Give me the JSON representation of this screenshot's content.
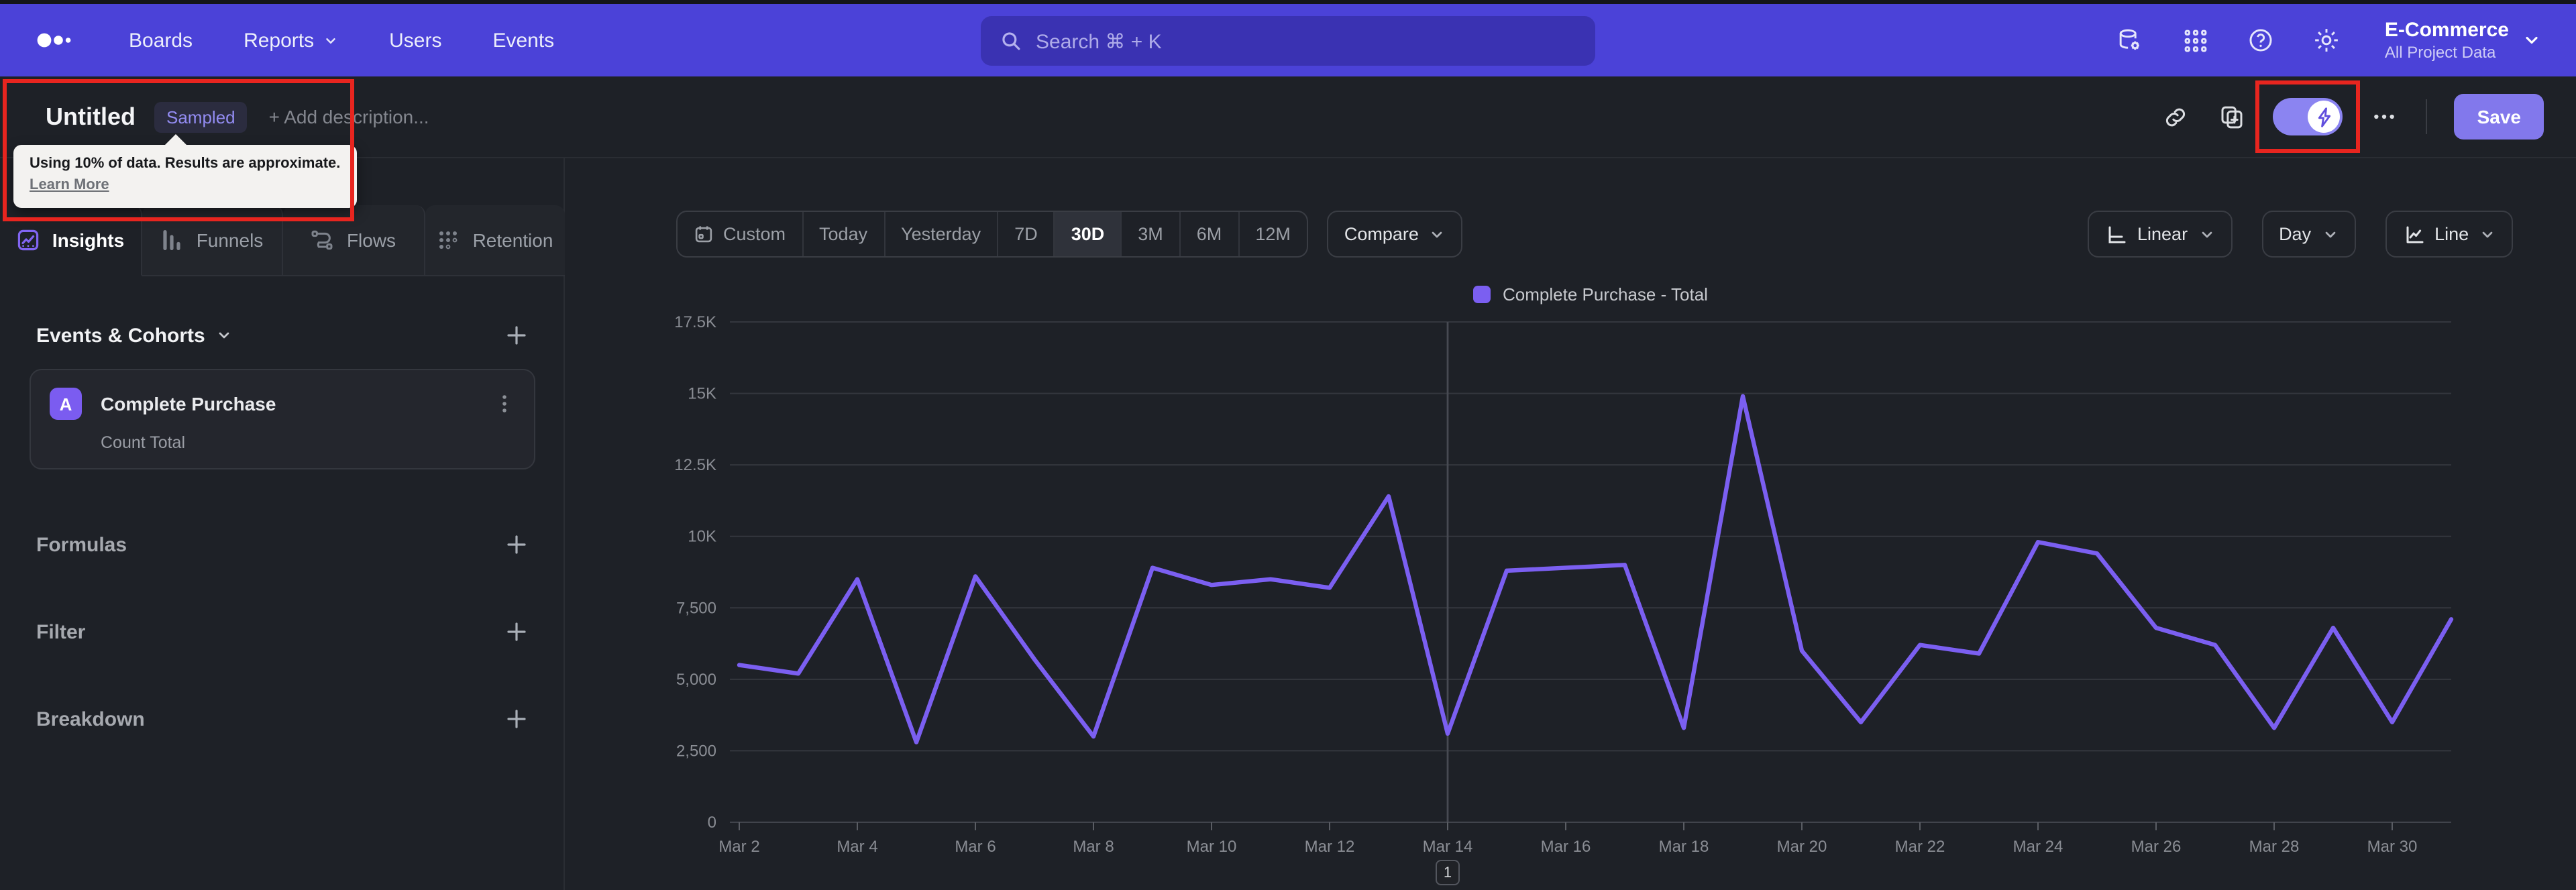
{
  "colors": {
    "nav_background": "#4b42d8",
    "page_background": "#1e2127",
    "accent_purple": "#7b5ff1",
    "save_button": "#8278ec",
    "annotation_red": "#e8251f",
    "tooltip_background": "#f3f2f0"
  },
  "nav": {
    "links": [
      "Boards",
      "Reports",
      "Users",
      "Events"
    ],
    "search_placeholder": "Search  ⌘ + K",
    "project": {
      "name": "E-Commerce",
      "scope": "All Project Data"
    }
  },
  "titlebar": {
    "title": "Untitled",
    "badge": "Sampled",
    "add_description": "+ Add description...",
    "save_label": "Save"
  },
  "tooltip": {
    "line1": "Using 10% of data. Results are approximate.",
    "link": "Learn More"
  },
  "sidebar": {
    "tabs": [
      "Insights",
      "Funnels",
      "Flows",
      "Retention"
    ],
    "active_tab": "Insights",
    "events_header": "Events & Cohorts",
    "event": {
      "letter": "A",
      "name": "Complete Purchase",
      "metric": "Count Total"
    },
    "sections": [
      "Formulas",
      "Filter",
      "Breakdown"
    ]
  },
  "controls": {
    "date_ranges": [
      "Custom",
      "Today",
      "Yesterday",
      "7D",
      "30D",
      "3M",
      "6M",
      "12M"
    ],
    "active_range": "30D",
    "compare": "Compare",
    "scale": "Linear",
    "granularity": "Day",
    "chart_type": "Line"
  },
  "chart_data": {
    "type": "line",
    "title": "",
    "categories": [
      "Mar 2",
      "Mar 3",
      "Mar 4",
      "Mar 5",
      "Mar 6",
      "Mar 7",
      "Mar 8",
      "Mar 9",
      "Mar 10",
      "Mar 11",
      "Mar 12",
      "Mar 13",
      "Mar 14",
      "Mar 15",
      "Mar 16",
      "Mar 17",
      "Mar 18",
      "Mar 19",
      "Mar 20",
      "Mar 21",
      "Mar 22",
      "Mar 23",
      "Mar 24",
      "Mar 25",
      "Mar 26",
      "Mar 27",
      "Mar 28",
      "Mar 29",
      "Mar 30",
      "Mar 31"
    ],
    "series": [
      {
        "name": "Complete Purchase - Total",
        "color": "#7b5ff1",
        "values": [
          5500,
          5200,
          8500,
          2800,
          8600,
          5700,
          3000,
          8900,
          8300,
          8500,
          8200,
          11400,
          3100,
          8800,
          8900,
          9000,
          3300,
          14900,
          6000,
          3500,
          6200,
          5900,
          9800,
          9400,
          6800,
          6200,
          3300,
          6800,
          3500,
          7100
        ]
      }
    ],
    "xlabel": "",
    "ylabel": "",
    "ylim": [
      0,
      17500
    ],
    "yticks": [
      {
        "value": 0,
        "label": "0"
      },
      {
        "value": 2500,
        "label": "2,500"
      },
      {
        "value": 5000,
        "label": "5,000"
      },
      {
        "value": 7500,
        "label": "7,500"
      },
      {
        "value": 10000,
        "label": "10K"
      },
      {
        "value": 12500,
        "label": "12.5K"
      },
      {
        "value": 15000,
        "label": "15K"
      },
      {
        "value": 17500,
        "label": "17.5K"
      }
    ],
    "xtick_every": 2,
    "grid": true,
    "legend": {
      "label": "Complete Purchase - Total",
      "position": "top-center"
    },
    "annotation": {
      "index": 12,
      "category": "Mar 14",
      "label": "1"
    }
  }
}
